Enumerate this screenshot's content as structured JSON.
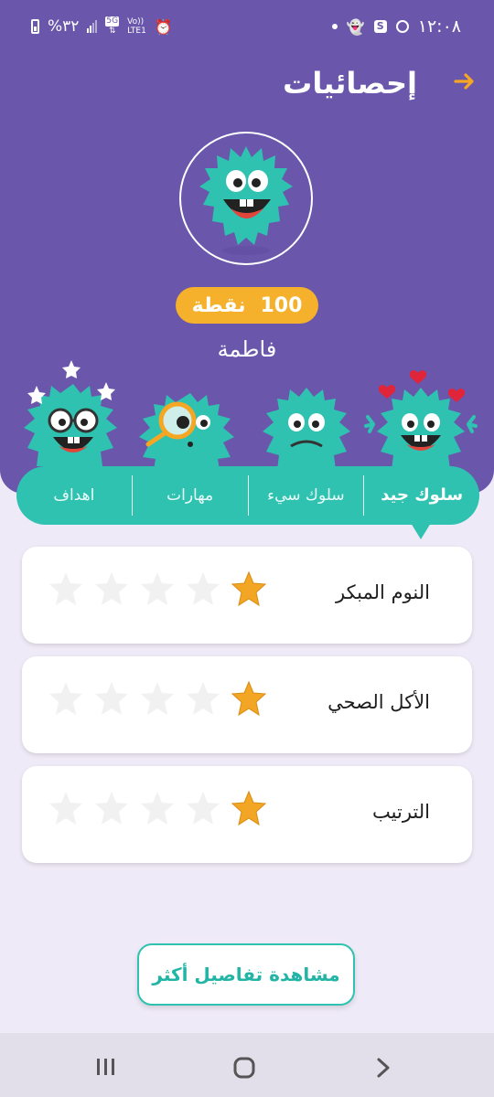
{
  "status_bar": {
    "time": "١٢:٠٨",
    "battery": "%٣٢",
    "network_5g": "5G",
    "volte": "Vo))",
    "lte": "LTE1"
  },
  "header": {
    "title": "إحصائيات",
    "points_value": "100",
    "points_label": "نقطة",
    "user_name": "فاطمة"
  },
  "tabs": [
    {
      "label": "سلوك جيد",
      "active": true
    },
    {
      "label": "سلوك سيء",
      "active": false
    },
    {
      "label": "مهارات",
      "active": false
    },
    {
      "label": "اهداف",
      "active": false
    }
  ],
  "behaviors": [
    {
      "label": "النوم المبكر",
      "rating": 1,
      "max": 5
    },
    {
      "label": "الأكل الصحي",
      "rating": 1,
      "max": 5
    },
    {
      "label": "الترتيب",
      "rating": 1,
      "max": 5
    }
  ],
  "actions": {
    "details_button": "مشاهدة تفاصيل أكثر"
  },
  "colors": {
    "primary_purple": "#6a56ab",
    "accent_teal": "#2fc2b1",
    "points_orange": "#f5b12b",
    "star_active": "#f3a623",
    "star_inactive": "#f1f1f1"
  }
}
